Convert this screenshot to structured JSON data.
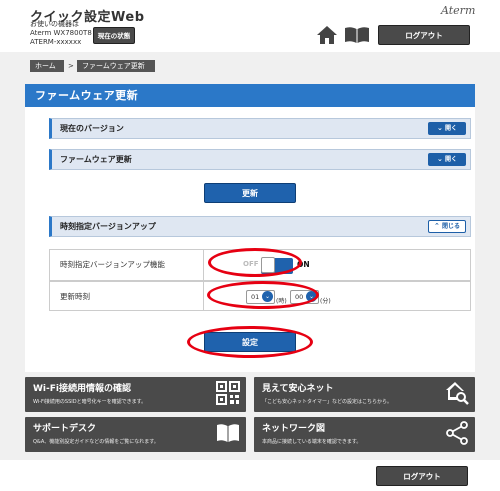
{
  "header": {
    "app_title": "クイック設定Web",
    "device_line1": "お使いの機器は",
    "device_line2": "Aterm WX7800T8",
    "device_line3": "ATERM-xxxxxx",
    "status_button": "現在の状態",
    "logo": "Aterm",
    "logout": "ログアウト"
  },
  "breadcrumb": {
    "home": "ホーム",
    "separator": ">",
    "current": "ファームウェア更新"
  },
  "panel": {
    "title": "ファームウェア更新",
    "sections": [
      {
        "label": "現在のバージョン",
        "toggle": "開く"
      },
      {
        "label": "ファームウェア更新",
        "toggle": "開く"
      }
    ],
    "update_button": "更新",
    "scheduled": {
      "label": "時刻指定バージョンアップ",
      "toggle": "閉じる",
      "feature_label": "時刻指定バージョンアップ機能",
      "off_text": "OFF",
      "on_text": "ON",
      "time_label": "更新時刻",
      "hour": "01",
      "hour_unit": "(時)",
      "minute": "00",
      "minute_unit": "(分)"
    },
    "set_button": "設定"
  },
  "cards": [
    {
      "title": "Wi-Fi接続用情報の確認",
      "desc": "Wi-Fi接続用のSSIDと暗号化キーを確認できます。",
      "icon": "qr-code-icon"
    },
    {
      "title": "見えて安心ネット",
      "desc": "「こども安心ネットタイマー」などの設定はこちらから。",
      "icon": "home-search-icon"
    },
    {
      "title": "サポートデスク",
      "desc": "Q&A、機能別設定ガイドなどの情報をご覧になれます。",
      "icon": "book-icon"
    },
    {
      "title": "ネットワーク図",
      "desc": "本商品に接続している端末を確認できます。",
      "icon": "network-icon"
    }
  ],
  "footer": {
    "logout": "ログアウト"
  },
  "colors": {
    "accent": "#2b78c8",
    "button_dark": "#4a4a4a",
    "highlight": "#e60012"
  }
}
